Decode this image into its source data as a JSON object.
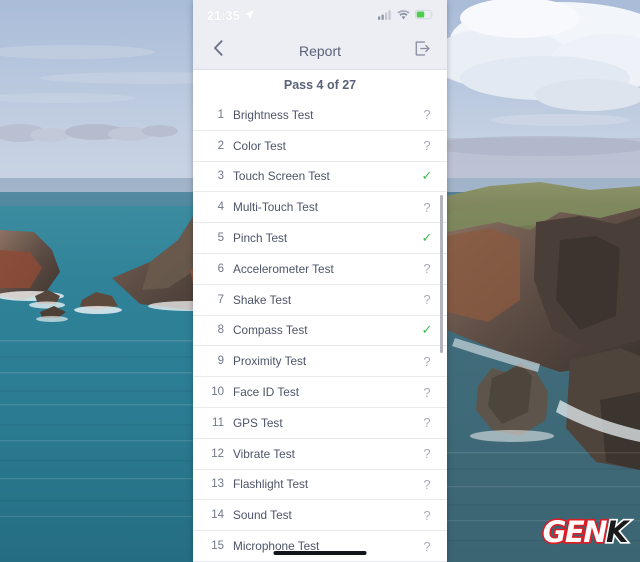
{
  "background": {
    "description": "coastal cliffs and turquoise sea photo wallpaper",
    "sky_color": "#b9c8de",
    "sea_color": "#2d7f95",
    "cliff_color": "#7d6a5a"
  },
  "watermark": {
    "text_light": "GEN",
    "text_dark": "K"
  },
  "phone": {
    "statusbar": {
      "time": "21:35",
      "location_icon": "location-arrow-icon",
      "signal_icon": "cellular-signal-icon",
      "wifi_icon": "wifi-icon",
      "battery_icon": "battery-charging-icon",
      "battery_color": "#4cd04c"
    },
    "navbar": {
      "back_icon": "chevron-left-icon",
      "title": "Report",
      "export_icon": "export-icon"
    },
    "summary": {
      "text": "Pass 4 of 27"
    },
    "list": {
      "status_pass_symbol": "✓",
      "status_unknown_symbol": "?",
      "pass_color": "#3cba54",
      "unknown_color": "#a7acb8",
      "items": [
        {
          "num": "1",
          "label": "Brightness Test",
          "status": "unknown"
        },
        {
          "num": "2",
          "label": "Color Test",
          "status": "unknown"
        },
        {
          "num": "3",
          "label": "Touch Screen Test",
          "status": "pass"
        },
        {
          "num": "4",
          "label": "Multi-Touch Test",
          "status": "unknown"
        },
        {
          "num": "5",
          "label": "Pinch Test",
          "status": "pass"
        },
        {
          "num": "6",
          "label": "Accelerometer Test",
          "status": "unknown"
        },
        {
          "num": "7",
          "label": "Shake Test",
          "status": "unknown"
        },
        {
          "num": "8",
          "label": "Compass Test",
          "status": "pass"
        },
        {
          "num": "9",
          "label": "Proximity Test",
          "status": "unknown"
        },
        {
          "num": "10",
          "label": "Face ID Test",
          "status": "unknown"
        },
        {
          "num": "11",
          "label": "GPS Test",
          "status": "unknown"
        },
        {
          "num": "12",
          "label": "Vibrate Test",
          "status": "unknown"
        },
        {
          "num": "13",
          "label": "Flashlight Test",
          "status": "unknown"
        },
        {
          "num": "14",
          "label": "Sound Test",
          "status": "unknown"
        },
        {
          "num": "15",
          "label": "Microphone Test",
          "status": "unknown"
        }
      ]
    }
  }
}
